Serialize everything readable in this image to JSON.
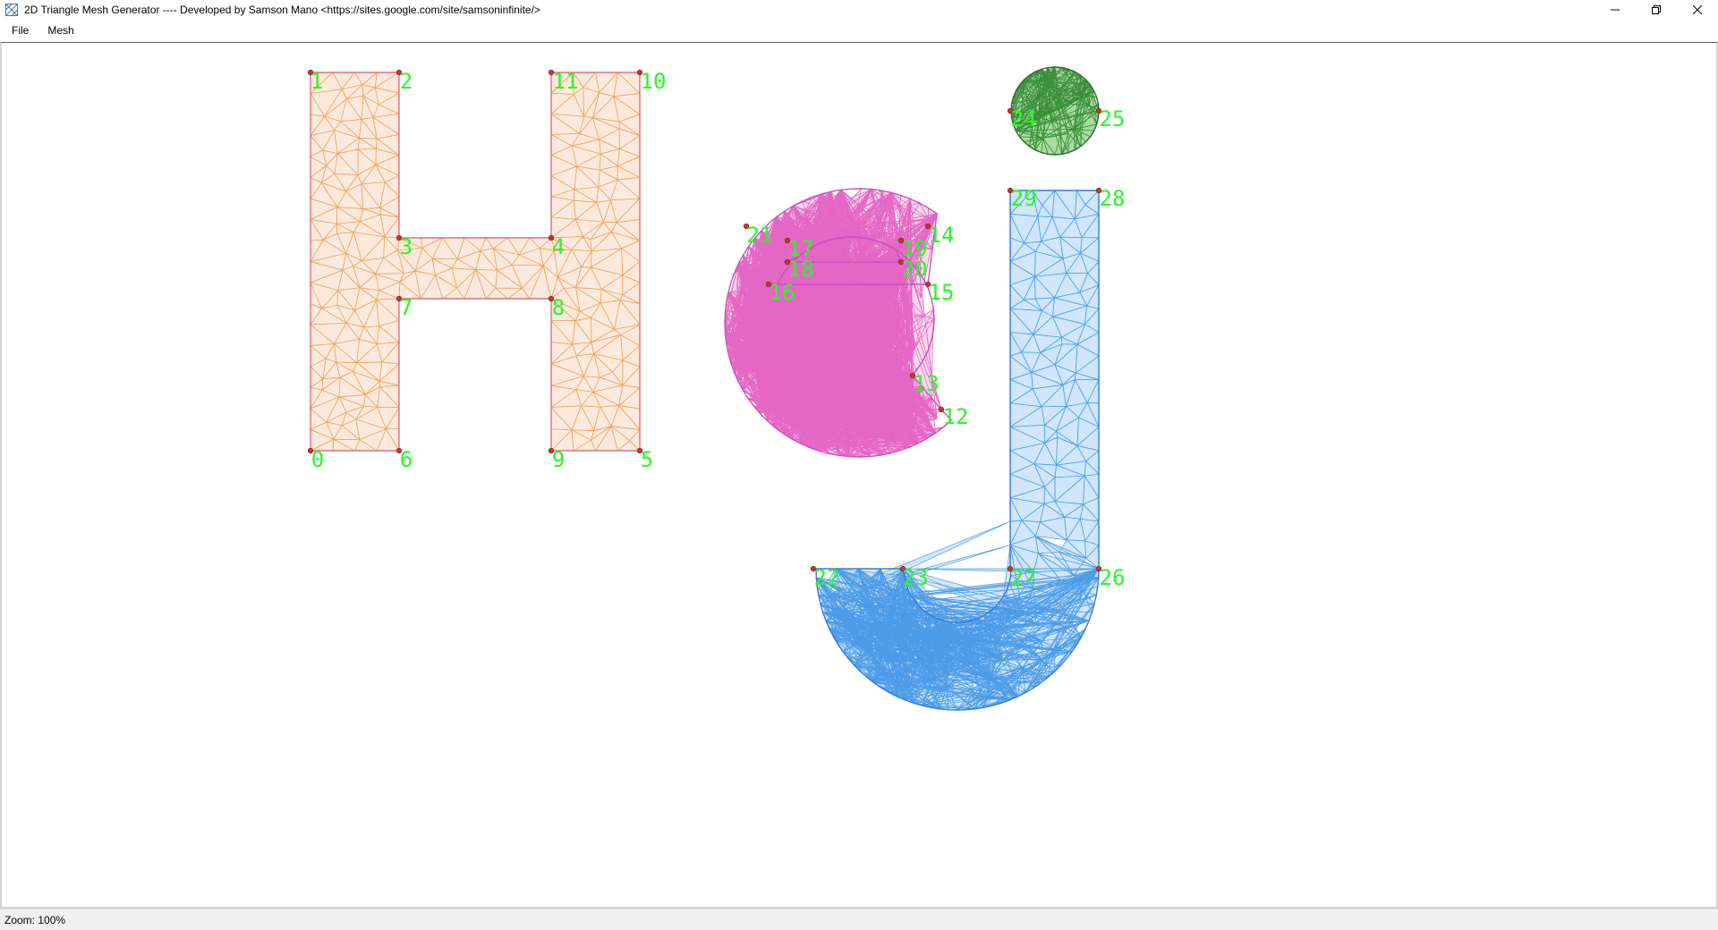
{
  "window": {
    "title": "2D Triangle Mesh Generator ---- Developed by Samson Mano <https://sites.google.com/site/samsoninfinite/>",
    "controls": [
      "minimize-icon",
      "restore-icon",
      "close-icon"
    ]
  },
  "menu": {
    "items": [
      {
        "label": "File"
      },
      {
        "label": "Mesh"
      }
    ]
  },
  "status": {
    "zoom_text": "Zoom: 100%"
  },
  "colors": {
    "h_fill": "#fbeadc",
    "h_edge": "#f0a160",
    "h_border": "#e0707a",
    "e_fill": "#fbd9ee",
    "e_edge": "#e468c4",
    "e_border": "#c850c0",
    "j_fill": "#cfe6fb",
    "j_edge": "#4d9ce8",
    "j_border": "#3a7ad8",
    "dot_fill": "#a9dca2",
    "dot_edge": "#3a8f3a",
    "dot_border": "#2a6a2a",
    "node_color": "#c0392b",
    "label_color": "#2bf52b"
  },
  "node_labels": [
    "0",
    "1",
    "2",
    "3",
    "4",
    "5",
    "6",
    "7",
    "8",
    "9",
    "10",
    "11",
    "12",
    "13",
    "14",
    "15",
    "16",
    "17",
    "18",
    "19",
    "20",
    "21",
    "22",
    "23",
    "24",
    "25",
    "26",
    "27",
    "28",
    "29"
  ]
}
